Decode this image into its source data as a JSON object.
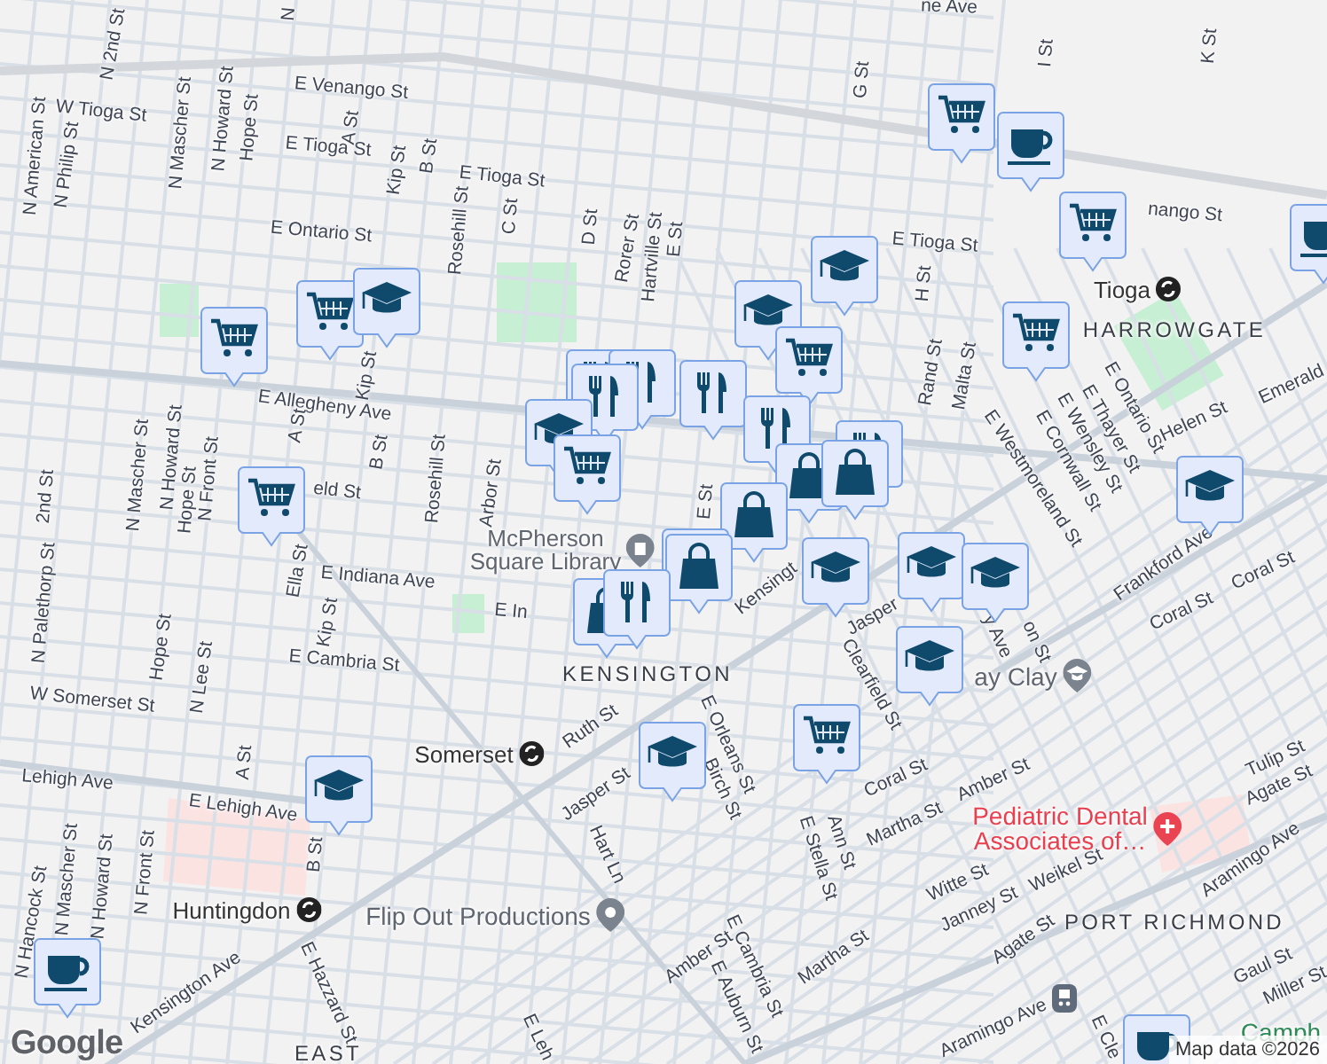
{
  "map": {
    "street_labels": [
      "N",
      "N 2nd St",
      "E Venango St",
      "W Tioga St",
      "N American St",
      "N Philip St",
      "N Mascher St",
      "N Howard St",
      "Hope St",
      "E Tioga St",
      "A St",
      "Kip St",
      "B St",
      "E Ontario St",
      "Rosehill St",
      "C St",
      "E Tioga St",
      "D St",
      "Rorer St",
      "Hartville St",
      "E St",
      "G St",
      "ne Ave",
      "I St",
      "K St",
      "nango St",
      "E Tioga St",
      "H St",
      "E Allegheny Ave",
      "N Mascher St",
      "N Howard St",
      "Hope St",
      "N Front St",
      "A St",
      "Kip St",
      "B St",
      "eld St",
      "2nd St",
      "Rosehill St",
      "Arbor St",
      "E St",
      "Rand St",
      "Malta St",
      "E Ontario St",
      "E Thayer St",
      "E Wensley St",
      "E Cornwall St",
      "E Westmoreland St",
      "Helen St",
      "Emerald",
      "Frankford Ave",
      "Coral St",
      "Coral St",
      "Kensingt",
      "y Ave",
      "on St",
      "Jasper",
      "Clearfield St",
      "E Indiana Ave",
      "E In",
      "Ella St",
      "Kip St",
      "E Cambria St",
      "N Palethorp St",
      "W Somerset St",
      "Hope St",
      "N Lee St",
      "Ruth St",
      "E Orleans St",
      "Birch St",
      "Jasper St",
      "Hart Ln",
      "Coral St",
      "Amber St",
      "Ann St",
      "E Stella St",
      "Martha St",
      "Lehigh Ave",
      "E Lehigh Ave",
      "A St",
      "N Hancock St",
      "N Mascher St",
      "N Howard St",
      "N Front St",
      "B St",
      "Kensington Ave",
      "E Hazzard St",
      "E Cambria St",
      "Amber St",
      "E Auburn St",
      "Martha St",
      "E Leh",
      "Tulip St",
      "Agate St",
      "Aramingo Ave",
      "Witte St",
      "Janney St",
      "Weikel St",
      "Agate St",
      "Gaul St",
      "Miller St",
      "Aramingo Ave",
      "E Cle"
    ],
    "area_labels": [
      "HARROWGATE",
      "KENSINGTON",
      "PORT RICHMOND",
      "EAST"
    ],
    "transit_stations": [
      "Tioga",
      "Somerset",
      "Huntingdon"
    ],
    "places": [
      {
        "name": "McPherson\nSquare Library",
        "kind": "library"
      },
      {
        "name": "Flip Out Productions",
        "kind": "place"
      },
      {
        "name": "ay Clay",
        "kind": "school"
      },
      {
        "name": "Pediatric Dental\nAssociates of…",
        "kind": "hospital"
      },
      {
        "name": "Camph",
        "kind": "park"
      }
    ],
    "markers": [
      {
        "kind": "cart"
      },
      {
        "kind": "cart"
      },
      {
        "kind": "school"
      },
      {
        "kind": "cart"
      },
      {
        "kind": "cart"
      },
      {
        "kind": "cafe"
      },
      {
        "kind": "cart"
      },
      {
        "kind": "cafe"
      },
      {
        "kind": "school"
      },
      {
        "kind": "school"
      },
      {
        "kind": "cart"
      },
      {
        "kind": "cart"
      },
      {
        "kind": "school"
      },
      {
        "kind": "restaurant"
      },
      {
        "kind": "restaurant"
      },
      {
        "kind": "restaurant"
      },
      {
        "kind": "restaurant"
      },
      {
        "kind": "restaurant"
      },
      {
        "kind": "school"
      },
      {
        "kind": "cart"
      },
      {
        "kind": "restaurant"
      },
      {
        "kind": "shopping"
      },
      {
        "kind": "shopping"
      },
      {
        "kind": "shopping"
      },
      {
        "kind": "restaurant"
      },
      {
        "kind": "shopping"
      },
      {
        "kind": "shopping"
      },
      {
        "kind": "restaurant"
      },
      {
        "kind": "school"
      },
      {
        "kind": "school"
      },
      {
        "kind": "school"
      },
      {
        "kind": "school"
      },
      {
        "kind": "school"
      },
      {
        "kind": "cart"
      },
      {
        "kind": "school"
      },
      {
        "kind": "cafe"
      },
      {
        "kind": "cafe"
      }
    ]
  },
  "attribution": {
    "logo": "Google",
    "map_data": "Map data ©2026"
  }
}
